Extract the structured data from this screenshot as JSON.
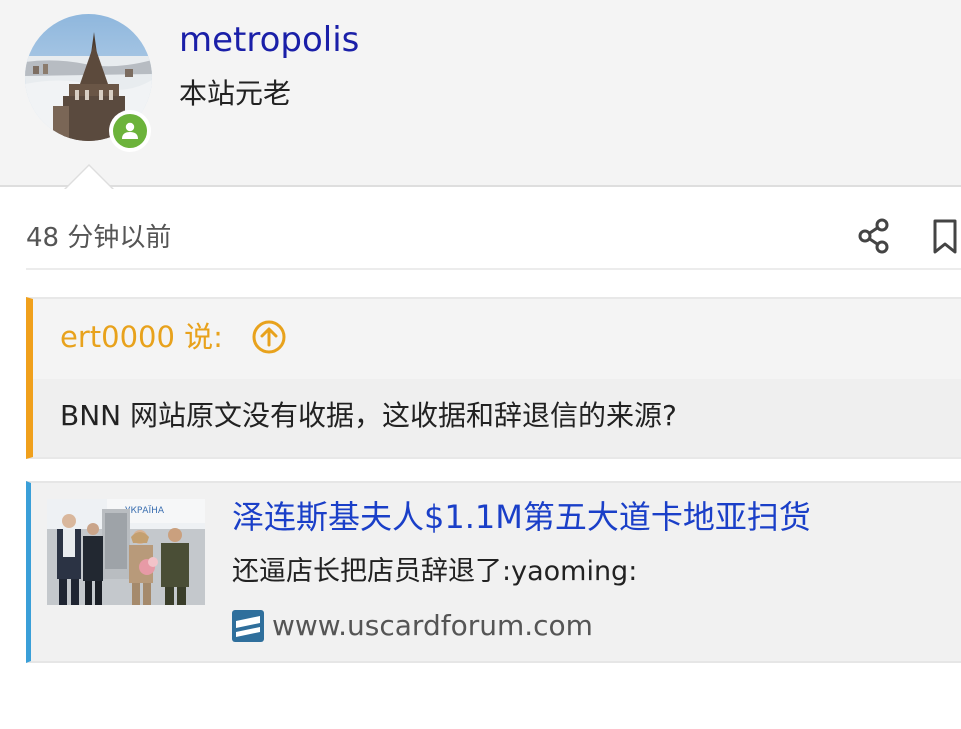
{
  "user": {
    "username": "metropolis",
    "title": "本站元老",
    "avatar_icon": "user-avatar-photo",
    "status_icon": "online-user-badge",
    "status_color": "#6cb33b"
  },
  "post": {
    "timestamp": "48 分钟以前",
    "actions": {
      "share_icon": "share-icon",
      "bookmark_icon": "bookmark-icon"
    }
  },
  "quote": {
    "author": "ert0000 说:",
    "up_icon": "arrow-up-circle-icon",
    "text": "BNN 网站原文没有收据，这收据和辞退信的来源?",
    "accent_color": "#f0a01c"
  },
  "onebox": {
    "title": "泽连斯基夫人$1.1M第五大道卡地亚扫货",
    "excerpt": "还逼店长把店员辞退了:yaoming:",
    "domain": "www.uscardforum.com",
    "favicon_icon": "uscardforum-favicon",
    "thumbnail_icon": "news-photo-thumbnail",
    "thumbnail_caption": "УКРАЇНА",
    "accent_color": "#3a9fd8"
  },
  "colors": {
    "username": "#1a1fa8",
    "link_title": "#1a3fc8",
    "quote_author": "#e8a21c"
  }
}
